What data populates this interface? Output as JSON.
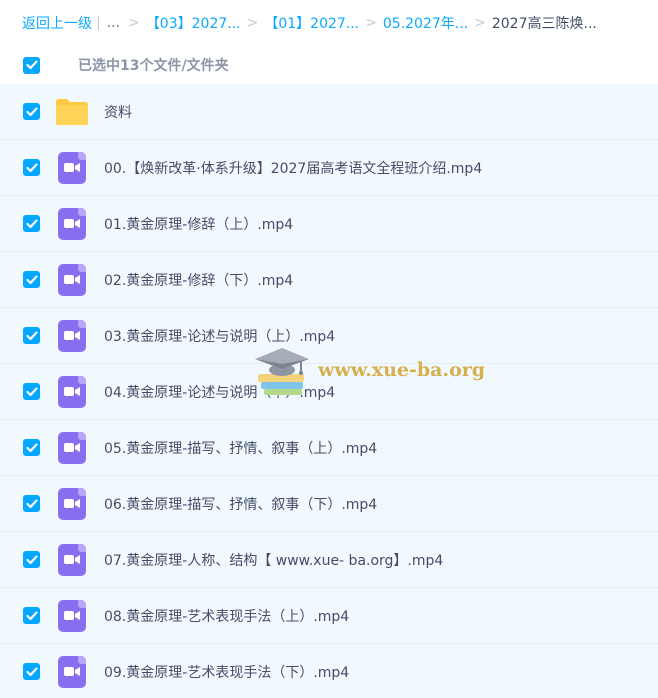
{
  "breadcrumb": {
    "back_label": "返回上一级",
    "divider": "|",
    "ellipsis": "...",
    "separator": ">",
    "crumbs": [
      "【03】2027...",
      "【01】2027...",
      "05.2027年..."
    ],
    "current": "2027高三陈焕..."
  },
  "selection": {
    "summary": "已选中13个文件/文件夹"
  },
  "files": [
    {
      "name": "资料",
      "type": "folder",
      "checked": true
    },
    {
      "name": "00.【焕新改革·体系升级】2027届高考语文全程班介绍.mp4",
      "type": "video",
      "checked": true
    },
    {
      "name": "01.黄金原理-修辞（上）.mp4",
      "type": "video",
      "checked": true
    },
    {
      "name": "02.黄金原理-修辞（下）.mp4",
      "type": "video",
      "checked": true
    },
    {
      "name": "03.黄金原理-论述与说明（上）.mp4",
      "type": "video",
      "checked": true
    },
    {
      "name": "04.黄金原理-论述与说明（下）.mp4",
      "type": "video",
      "checked": true
    },
    {
      "name": "05.黄金原理-描写、抒情、叙事（上）.mp4",
      "type": "video",
      "checked": true
    },
    {
      "name": "06.黄金原理-描写、抒情、叙事（下）.mp4",
      "type": "video",
      "checked": true
    },
    {
      "name": "07.黄金原理-人称、结构【 www.xue- ba.org】.mp4",
      "type": "video",
      "checked": true
    },
    {
      "name": "08.黄金原理-艺术表现手法（上）.mp4",
      "type": "video",
      "checked": true
    },
    {
      "name": "09.黄金原理-艺术表现手法（下）.mp4",
      "type": "video",
      "checked": true
    }
  ],
  "watermark": {
    "text": "www.xue-ba.org",
    "logo_icon": "graduation-cap-books-icon"
  },
  "colors": {
    "accent": "#06a7ff",
    "link": "#09aaff",
    "row_bg": "#f1f9ff",
    "video_icon": "#8a6ef2",
    "folder_icon": "#fcc93f"
  }
}
